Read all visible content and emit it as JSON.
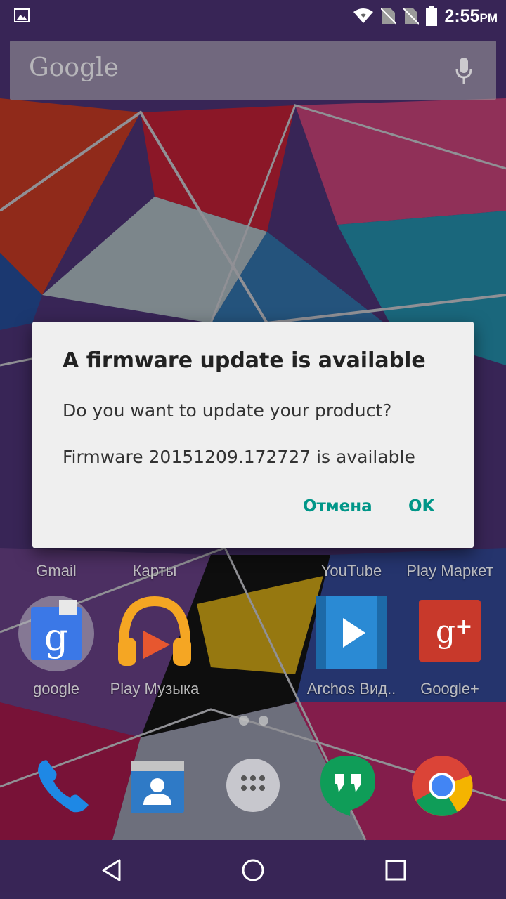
{
  "status_bar": {
    "time": "2:55",
    "ampm": "PM",
    "icons": [
      "image-notification-icon",
      "wifi-icon",
      "no-sim-icon",
      "no-sim-icon",
      "battery-icon"
    ]
  },
  "search": {
    "logo_text": "Google",
    "icons": [
      "mic-icon"
    ]
  },
  "home": {
    "row1": [
      "Gmail",
      "Карты",
      "YouTube",
      "Play Маркет"
    ],
    "row2": [
      "google",
      "Play Музыка",
      "Archos Вид..",
      "Google+"
    ],
    "dock": [
      "phone-icon",
      "contacts-icon",
      "app-drawer-icon",
      "hangouts-icon",
      "chrome-icon"
    ]
  },
  "dialog": {
    "title": "A firmware update is available",
    "message": "Do you want to update your product?",
    "detail": "Firmware 20151209.172727 is available",
    "cancel_label": "Отмена",
    "ok_label": "OK",
    "accent_color": "#009688"
  },
  "nav": {
    "icons": [
      "back-icon",
      "home-icon",
      "recents-icon"
    ]
  }
}
